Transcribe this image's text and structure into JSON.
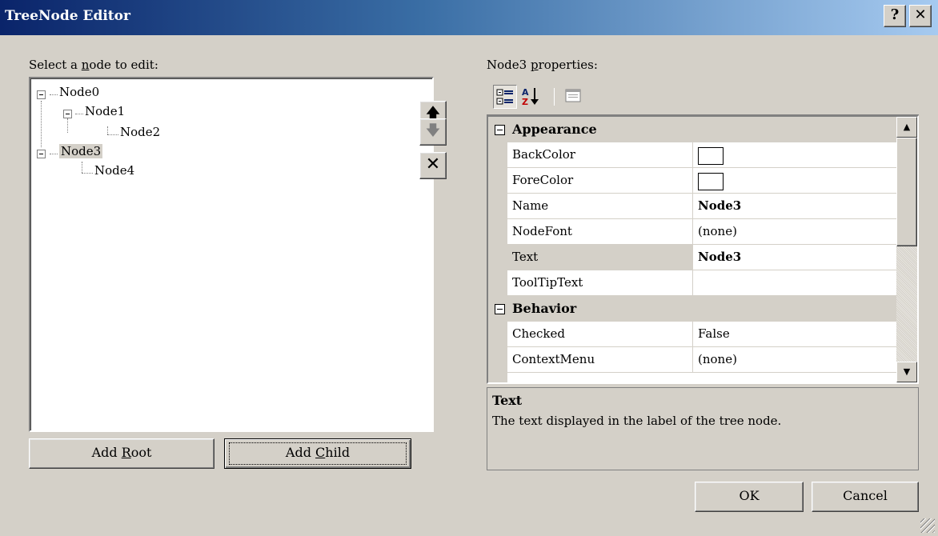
{
  "window": {
    "title": "TreeNode Editor",
    "help_glyph": "?",
    "close_glyph": "✕"
  },
  "tree_panel": {
    "label_pre": "Select a ",
    "label_key": "n",
    "label_post": "ode to edit:",
    "nodes": [
      {
        "text": "Node0",
        "level": 0
      },
      {
        "text": "Node1",
        "level": 1
      },
      {
        "text": "Node2",
        "level": 2
      },
      {
        "text": "Node3",
        "level": 0,
        "selected": true
      },
      {
        "text": "Node4",
        "level": 1
      }
    ],
    "move_up_glyph": "🡅",
    "move_down_glyph": "🡇",
    "delete_glyph": "✕"
  },
  "buttons": {
    "add_root_pre": "Add ",
    "add_root_key": "R",
    "add_root_post": "oot",
    "add_child_pre": "Add ",
    "add_child_key": "C",
    "add_child_post": "hild",
    "ok": "OK",
    "cancel": "Cancel"
  },
  "properties": {
    "label_pre": "Node3 ",
    "label_key": "p",
    "label_post": "roperties:",
    "categories": [
      {
        "name": "Appearance",
        "rows": [
          {
            "name": "BackColor",
            "value": "",
            "swatch": "#ffffff"
          },
          {
            "name": "ForeColor",
            "value": "",
            "swatch": "#ffffff"
          },
          {
            "name": "Name",
            "value": "Node3",
            "bold": true
          },
          {
            "name": "NodeFont",
            "value": "(none)"
          },
          {
            "name": "Text",
            "value": "Node3",
            "bold": true,
            "selected": true
          },
          {
            "name": "ToolTipText",
            "value": ""
          }
        ]
      },
      {
        "name": "Behavior",
        "rows": [
          {
            "name": "Checked",
            "value": "False"
          },
          {
            "name": "ContextMenu",
            "value": "(none)"
          }
        ]
      }
    ],
    "description": {
      "title": "Text",
      "text": "The text displayed in the label of the tree node."
    }
  }
}
